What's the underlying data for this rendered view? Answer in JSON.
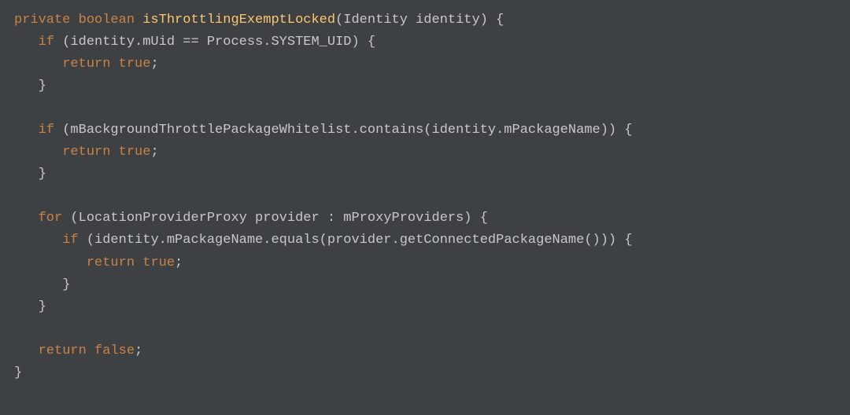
{
  "code": {
    "line1": {
      "kw1": "private boolean",
      "method": "isThrottlingExemptLocked",
      "rest": "(Identity identity) {"
    },
    "line2": {
      "kw": "if",
      "rest": " (identity.mUid == Process.SYSTEM_UID) {"
    },
    "line3": {
      "kw": "return true",
      "rest": ";"
    },
    "line4": "}",
    "line5": "",
    "line6": {
      "kw": "if",
      "rest": " (mBackgroundThrottlePackageWhitelist.contains(identity.mPackageName)) {"
    },
    "line7": {
      "kw": "return true",
      "rest": ";"
    },
    "line8": "}",
    "line9": "",
    "line10": {
      "kw": "for",
      "rest": " (LocationProviderProxy provider : mProxyProviders) {"
    },
    "line11": {
      "kw": "if",
      "rest": " (identity.mPackageName.equals(provider.getConnectedPackageName())) {"
    },
    "line12": {
      "kw": "return true",
      "rest": ";"
    },
    "line13": "}",
    "line14": "}",
    "line15": "",
    "line16": {
      "kw": "return false",
      "rest": ";"
    },
    "line17": "}"
  }
}
